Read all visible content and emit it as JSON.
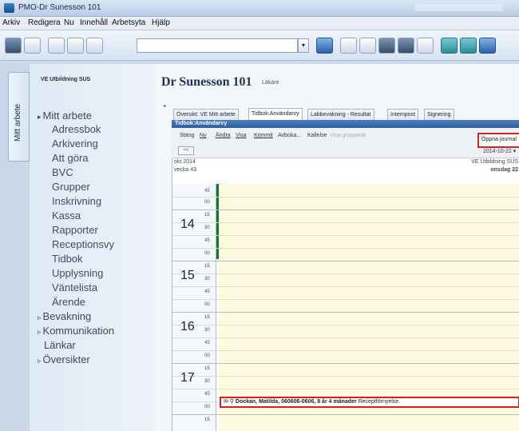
{
  "window": {
    "title": "PMO-Dr Sunesson 101"
  },
  "menu": [
    "Arkiv",
    "Redigera",
    "Nu",
    "Innehåll",
    "Arbetsyta",
    "Hjälp"
  ],
  "sidebar": {
    "tab_label": "Mitt arbete",
    "header": "VE Utbildning SUS",
    "items": [
      {
        "label": "Mitt arbete",
        "level": 0
      },
      {
        "label": "Adressbok",
        "level": 1
      },
      {
        "label": "Arkivering",
        "level": 1
      },
      {
        "label": "Att göra",
        "level": 1
      },
      {
        "label": "BVC",
        "level": 1
      },
      {
        "label": "Grupper",
        "level": 1
      },
      {
        "label": "Inskrivning",
        "level": 1
      },
      {
        "label": "Kassa",
        "level": 1
      },
      {
        "label": "Rapporter",
        "level": 1
      },
      {
        "label": "Receptionsvy",
        "level": 1
      },
      {
        "label": "Tidbok",
        "level": 1
      },
      {
        "label": "Upplysning",
        "level": 1
      },
      {
        "label": "Väntelista",
        "level": 1
      },
      {
        "label": "Ärende",
        "level": 1
      },
      {
        "label": "Bevakning",
        "level": 0
      },
      {
        "label": "Kommunikation",
        "level": 0
      },
      {
        "label": "Länkar",
        "level": 0
      },
      {
        "label": "Översikter",
        "level": 0
      }
    ]
  },
  "header": {
    "title": "Dr Sunesson 101",
    "subtitle": "Läkare"
  },
  "tabs": [
    {
      "label": "Översikt: VE Mitt arbete"
    },
    {
      "label": "Tidbok:Användarvy"
    },
    {
      "label": "Labbevakning - Resultat"
    },
    {
      "label": "Internpost"
    },
    {
      "label": "Signering"
    }
  ],
  "panel": {
    "title": "Tidbok:Användarvy",
    "toolbar": [
      "Stäng",
      "Ny",
      "Ändra",
      "Visa",
      "Kommit",
      "Avboka...",
      "Kallelse"
    ],
    "faded_label": "Visa grupperat",
    "open_button": "Öppna journal",
    "small_button": "<<",
    "date": "2014-10-22"
  },
  "calendar": {
    "year_label": "okt 2014",
    "week_label": "vecka 43",
    "unit": "VE Utbildning SUS",
    "day": "onsdag 22",
    "hours": [
      "14",
      "15",
      "16",
      "17"
    ],
    "appointment": {
      "time": "00",
      "patient": "Dockan, Matilda, 060606-0606, 8 år 4 månader",
      "note": "Receptförnyelse."
    }
  }
}
